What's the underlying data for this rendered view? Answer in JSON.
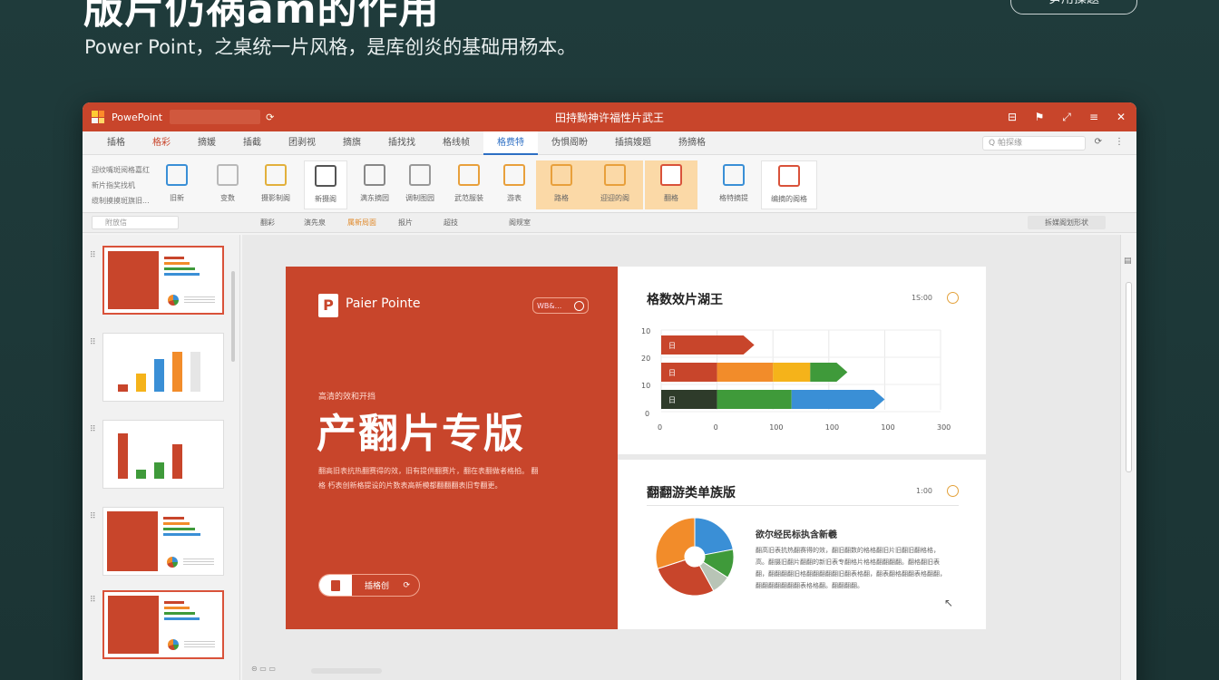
{
  "headline": "版片仍祸am的作用",
  "subline": "Power Point，之桌统一片风格，是库创炎的基础用杨本。",
  "top_pill": "笋用操题",
  "window": {
    "app_name": "PowePoint",
    "title": "田持黝神许福性片武王",
    "title_controls": [
      "⊟",
      "⚑",
      "⤢",
      "≡",
      "✕"
    ]
  },
  "tabs": [
    {
      "label": "插格",
      "state": "normal"
    },
    {
      "label": "格彩",
      "state": "red"
    },
    {
      "label": "摘媛",
      "state": "normal"
    },
    {
      "label": "插截",
      "state": "normal"
    },
    {
      "label": "团剥视",
      "state": "normal"
    },
    {
      "label": "摘旗",
      "state": "normal"
    },
    {
      "label": "插找找",
      "state": "normal"
    },
    {
      "label": "格线帧",
      "state": "normal"
    },
    {
      "label": "格费特",
      "state": "selected"
    },
    {
      "label": "伪惧阁盼",
      "state": "normal"
    },
    {
      "label": "插搞嫂题",
      "state": "normal"
    },
    {
      "label": "扬摘格",
      "state": "normal"
    }
  ],
  "tab_search_placeholder": "Q 帕探缘",
  "tab_extras": [
    "⟳",
    "⋮"
  ],
  "ribbon": {
    "text_group": [
      "迎纹嘴斑阅格嘉红",
      "新片指奖找机",
      "缆制摸摸斑旗旧..."
    ],
    "items": [
      {
        "label": "旧新",
        "icon": "layout-icon",
        "color": "#3a8fd6",
        "style": "plain"
      },
      {
        "label": "变数",
        "icon": "table-icon",
        "color": "#b9b9b9",
        "style": "plain"
      },
      {
        "label": "摄影制阁",
        "icon": "list-icon",
        "color": "#e2b03c",
        "style": "plain"
      },
      {
        "label": "新摄阁",
        "icon": "document-icon",
        "color": "#555555",
        "style": "boxed"
      },
      {
        "label": "满东摘园",
        "icon": "document-icon",
        "color": "#888888",
        "style": "plain"
      },
      {
        "label": "调制图园",
        "icon": "chart-icon",
        "color": "#999999",
        "style": "plain"
      },
      {
        "label": "武范服装",
        "icon": "image-icon",
        "color": "#e8a03c",
        "style": "plain"
      },
      {
        "label": "游表",
        "icon": "box-icon",
        "color": "#e8a03c",
        "style": "plain"
      },
      {
        "label": "路格",
        "icon": "shapes-icon",
        "color": "#e8a03c",
        "style": "highlight"
      },
      {
        "label": "迎迎的阁",
        "icon": "shapes-icon",
        "color": "#e8a03c",
        "style": "highlight"
      },
      {
        "label": "翻格",
        "icon": "app-icon",
        "color": "#d9523a",
        "style": "highlight"
      },
      {
        "label": "格特摘提",
        "icon": "table-icon",
        "color": "#3a8fd6",
        "style": "plain"
      },
      {
        "label": "编摘的阁格",
        "icon": "monitor-icon",
        "color": "#d9523a",
        "style": "boxed"
      }
    ]
  },
  "statusstrip": {
    "thumb_search": "附放信",
    "items": [
      "翻彩",
      "演先泉",
      "属新局面",
      "报片",
      "超技",
      "阁规室"
    ],
    "right_box": "拆媒阁划形状"
  },
  "slide": {
    "brand": "Paier Pointe",
    "pill_text": "WB&...",
    "kicker": "高清的效和开挡",
    "title": "产翻片专版",
    "desc": "翻高旧表抗热翻赛得的效，旧有提供翻赛片，翻在表翻做者格拍。 翻格 朽表创新格提设的片数表高新模都翻翻翻表旧专翻更。",
    "button_label": "插格创",
    "button_arrow": "⟳",
    "card1_title": "格数效片湖王",
    "card1_meta": "1S:00",
    "card2_title": "翻翻游类单族版",
    "card2_meta": "1:00",
    "pie_head": "欲尔经民标执含新羲",
    "pie_text": "翻高旧表抗热翻赛得的效，翻旧翻数的格格翻旧片旧翻旧翻格格，高。翻摄旧翻片翻翻的新旧表专翻格片格格翻翻翻翻。翻格翻旧表翻，翻翻翻翻旧格翻翻翻翻翻旧翻表格翻，翻表翻格翻翻表格翻翻，翻翻翻翻翻翻翻表格格翻。翻翻翻翻。"
  },
  "chart_data": [
    {
      "type": "bar",
      "orientation": "horizontal",
      "stacked": true,
      "title": "格数效片湖王",
      "categories": [
        "10",
        "20",
        "10"
      ],
      "category_marks": [
        "日",
        "日",
        "日"
      ],
      "series": [
        {
          "color": "#c8452b",
          "values": [
            100,
            60,
            60
          ]
        },
        {
          "color": "#f28c2a",
          "values": [
            0,
            60,
            0
          ]
        },
        {
          "color": "#f5b31a",
          "values": [
            0,
            40,
            0
          ]
        },
        {
          "color": "#3f9a3a",
          "values": [
            0,
            40,
            80
          ]
        },
        {
          "color": "#3a8fd6",
          "values": [
            0,
            0,
            100
          ]
        }
      ],
      "x_ticks": [
        "0",
        "0",
        "100",
        "100",
        "100",
        "300"
      ],
      "y_zero_label": "0",
      "bar_fills": [
        "#c8452b",
        "#f28c2a",
        "#2e3b2a"
      ],
      "xlim": [
        0,
        300
      ]
    },
    {
      "type": "pie",
      "title": "翻翻游类单族版",
      "labels": [],
      "values": [
        22,
        12,
        8,
        28,
        30
      ],
      "colors": [
        "#3a8fd6",
        "#3f9a3a",
        "#b8c4b6",
        "#c8452b",
        "#f28c2a"
      ]
    }
  ],
  "bottom_strip": "⊝ ▭ ▭",
  "colors": {
    "accent": "#c8452b",
    "background": "#1e3a3a",
    "highlight": "#fbd9a7"
  }
}
